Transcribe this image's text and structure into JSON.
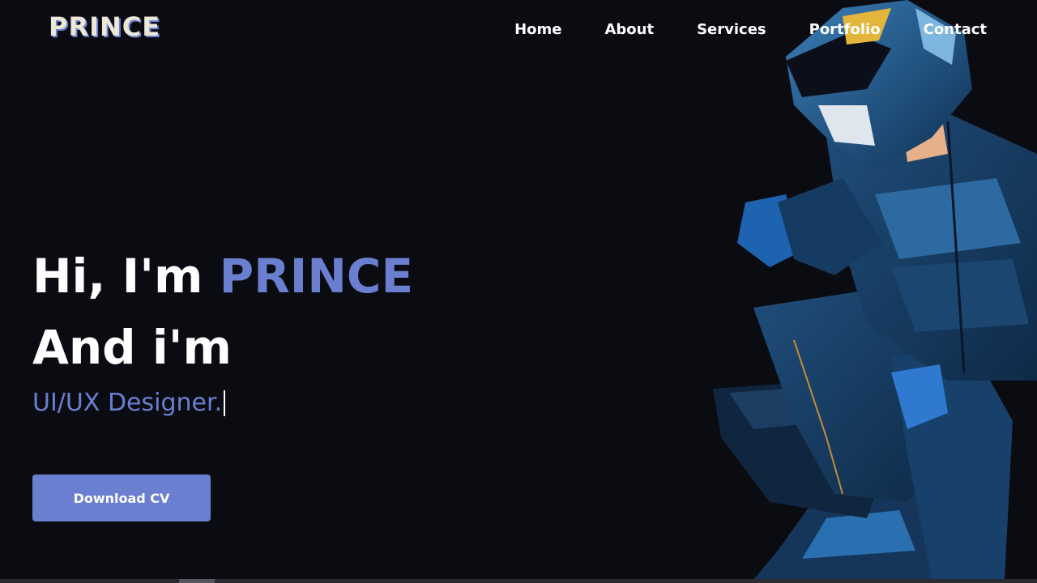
{
  "header": {
    "logo": "PRINCE",
    "nav": [
      {
        "label": "Home"
      },
      {
        "label": "About"
      },
      {
        "label": "Services"
      },
      {
        "label": "Portfolio"
      },
      {
        "label": "Contact"
      }
    ]
  },
  "hero": {
    "greeting_prefix": "Hi, I'm ",
    "name": "PRINCE",
    "line2": "And i'm",
    "role": "UI/UX Designer.",
    "cta_label": "Download CV"
  },
  "colors": {
    "background": "#0b0b12",
    "accent": "#6b7fd1",
    "text": "#ffffff"
  },
  "illustration": {
    "subject": "anime-style motorcycle rider in helmet and racing suit"
  }
}
